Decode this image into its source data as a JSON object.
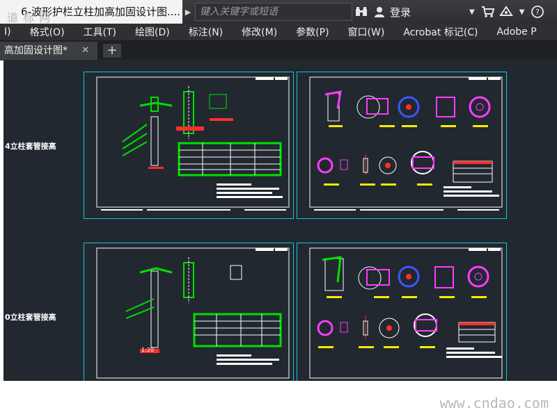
{
  "window": {
    "file_title": "6-波形护栏立柱加高加固设计图....",
    "watermark": "道 标 网",
    "search_placeholder": "键入关键字或短语",
    "login_label": "登录"
  },
  "menu": {
    "items": [
      "I)",
      "格式(O)",
      "工具(T)",
      "绘图(D)",
      "标注(N)",
      "修改(M)",
      "参数(P)",
      "窗口(W)",
      "Acrobat 标记(C)",
      "Adobe P"
    ]
  },
  "tabs": {
    "active_tab": "高加固设计图*",
    "close_glyph": "✕",
    "new_tab_glyph": "+"
  },
  "drawing": {
    "row_labels": [
      "4立柱套管接高",
      "0立柱套管接高"
    ],
    "scale_label": "1:20"
  },
  "footer": {
    "site_watermark": "www.cndao.com"
  },
  "colors": {
    "canvas": "#212830",
    "sheet_border": "#12c7d6",
    "table_border": "#00e000",
    "line_green": "#00e000",
    "line_yellow": "#f7ec00",
    "line_red": "#ff2e2e",
    "line_magenta": "#ff3cff",
    "line_blue": "#3b57ff",
    "text_white": "#ffffff"
  },
  "icons": {
    "binoculars": "binoculars-icon",
    "user": "user-icon",
    "cart": "cart-icon",
    "exchange": "exchange-icon",
    "help": "help-icon"
  }
}
